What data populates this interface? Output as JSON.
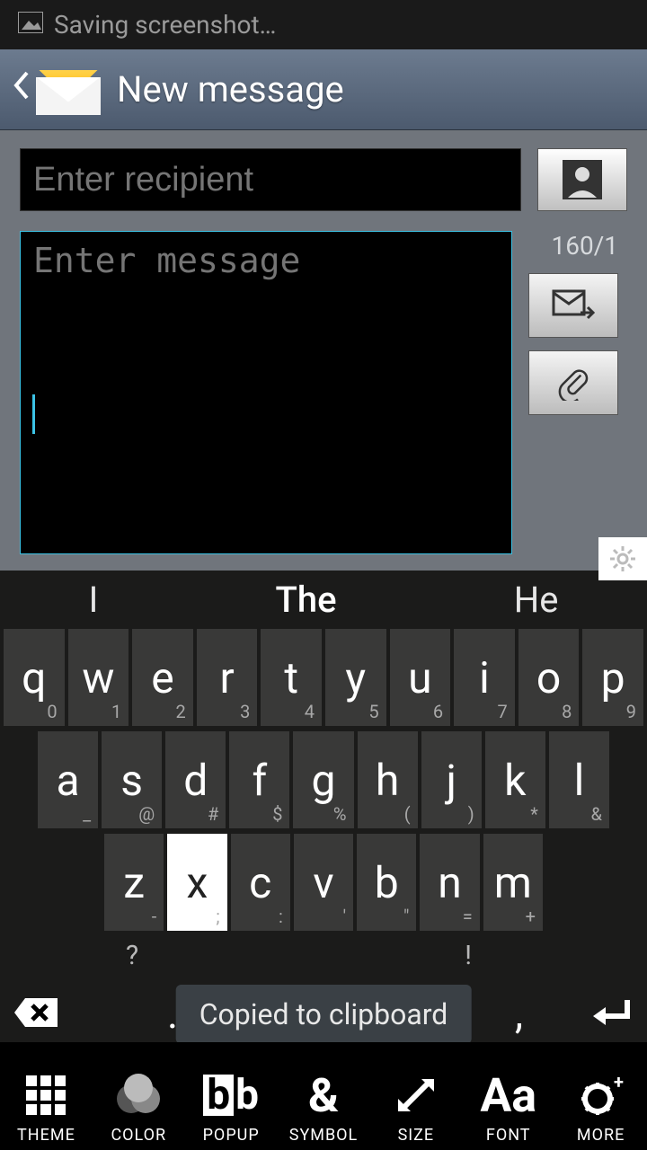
{
  "status": {
    "notification_text": "Saving screenshot…"
  },
  "header": {
    "title": "New message"
  },
  "compose": {
    "recipient_placeholder": "Enter recipient",
    "message_placeholder": "Enter message",
    "counter": "160/1"
  },
  "keyboard": {
    "suggestions": [
      "I",
      "The",
      "He"
    ],
    "row1": [
      {
        "k": "q",
        "s": "0"
      },
      {
        "k": "w",
        "s": "1"
      },
      {
        "k": "e",
        "s": "2"
      },
      {
        "k": "r",
        "s": "3"
      },
      {
        "k": "t",
        "s": "4"
      },
      {
        "k": "y",
        "s": "5"
      },
      {
        "k": "u",
        "s": "6"
      },
      {
        "k": "i",
        "s": "7"
      },
      {
        "k": "o",
        "s": "8"
      },
      {
        "k": "p",
        "s": "9"
      }
    ],
    "row2": [
      {
        "k": "a",
        "s": "_"
      },
      {
        "k": "s",
        "s": "@"
      },
      {
        "k": "d",
        "s": "#"
      },
      {
        "k": "f",
        "s": "$"
      },
      {
        "k": "g",
        "s": "%"
      },
      {
        "k": "h",
        "s": "("
      },
      {
        "k": "j",
        "s": ")"
      },
      {
        "k": "k",
        "s": "*"
      },
      {
        "k": "l",
        "s": "&"
      }
    ],
    "row3": [
      {
        "k": "z",
        "s": "-"
      },
      {
        "k": "x",
        "s": ";",
        "pressed": true
      },
      {
        "k": "c",
        "s": ":"
      },
      {
        "k": "v",
        "s": "'"
      },
      {
        "k": "b",
        "s": "\""
      },
      {
        "k": "n",
        "s": "="
      },
      {
        "k": "m",
        "s": "+"
      }
    ],
    "hint_left": "?",
    "hint_right": "!",
    "period": ".",
    "comma": ",",
    "toast": "Copied to clipboard"
  },
  "toolbar": {
    "items": [
      {
        "label": "THEME"
      },
      {
        "label": "COLOR"
      },
      {
        "label": "POPUP"
      },
      {
        "label": "SYMBOL"
      },
      {
        "label": "SIZE"
      },
      {
        "label": "FONT"
      },
      {
        "label": "MORE"
      }
    ],
    "symbol_glyph": "&",
    "font_glyph": "Aa"
  }
}
